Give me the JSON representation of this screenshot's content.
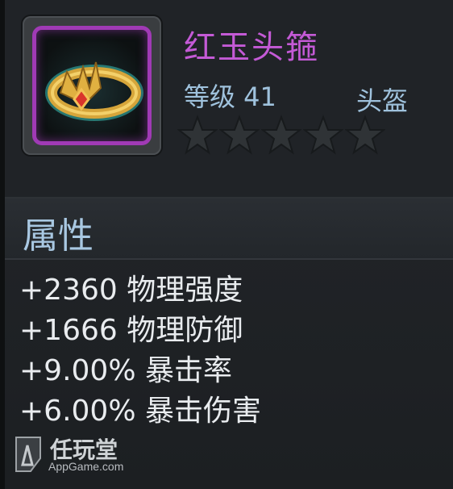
{
  "item": {
    "name": "红玉头箍",
    "level": "等级 41",
    "slot": "头盔",
    "stars_filled": 0,
    "stars_total": 5,
    "rarity_color": "#c45ad6"
  },
  "attributes": {
    "title": "属性",
    "stats": [
      "+2360 物理强度",
      "+1666 物理防御",
      "+9.00% 暴击率",
      "+6.00% 暴击伤害"
    ]
  },
  "watermark": {
    "brand": "任玩堂",
    "site": "AppGame.com"
  },
  "icons": {
    "item_icon": "gold-ring-crown-icon",
    "star": "star-icon",
    "logo": "appgame-logo-icon"
  }
}
